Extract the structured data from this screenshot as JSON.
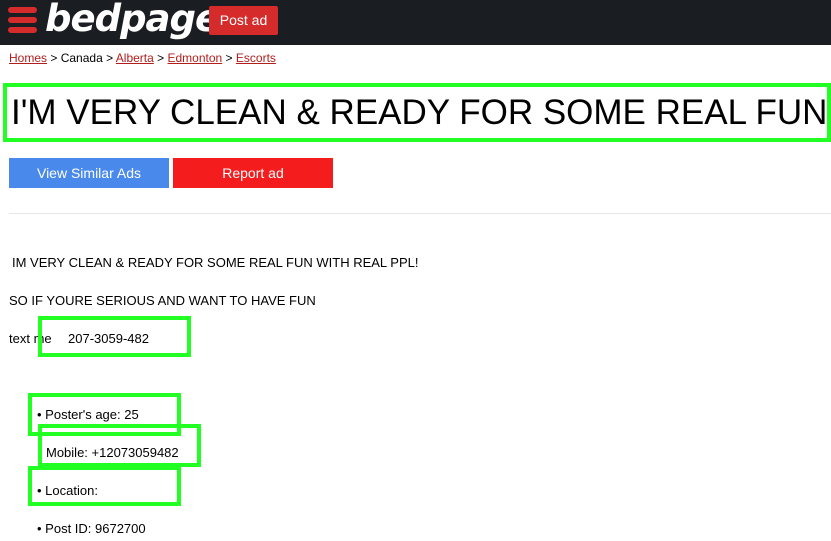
{
  "header": {
    "logo": "bedpage",
    "post_ad_label": "Post ad"
  },
  "breadcrumb": {
    "items": [
      "Homes",
      "Canada",
      "Alberta",
      "Edmonton",
      "Escorts"
    ],
    "separator": ">"
  },
  "ad": {
    "title": "I'M VERY CLEAN & READY FOR SOME REAL FUN WITH REAL PPL!",
    "view_similar_label": "View Similar Ads",
    "report_label": "Report ad",
    "body_line1": "IM VERY CLEAN & READY FOR SOME REAL FUN WITH REAL PPL!",
    "body_line2": "SO IF YOURE SERIOUS AND WANT TO HAVE FUN",
    "body_line3": "text me",
    "phone": "207-3059-482",
    "posters_age": "• Poster's age: 25",
    "mobile": "Mobile: +12073059482",
    "location": "• Location:",
    "post_id": "• Post ID: 9672700"
  },
  "colors": {
    "topbar": "#1a1d22",
    "brand_red": "#d52b2b",
    "similar_blue": "#4a89ec",
    "report_red": "#f41c1c",
    "highlight_green": "#22ff22",
    "link_red": "#b01e1e"
  },
  "icons": {
    "menu": "hamburger-menu-icon"
  }
}
